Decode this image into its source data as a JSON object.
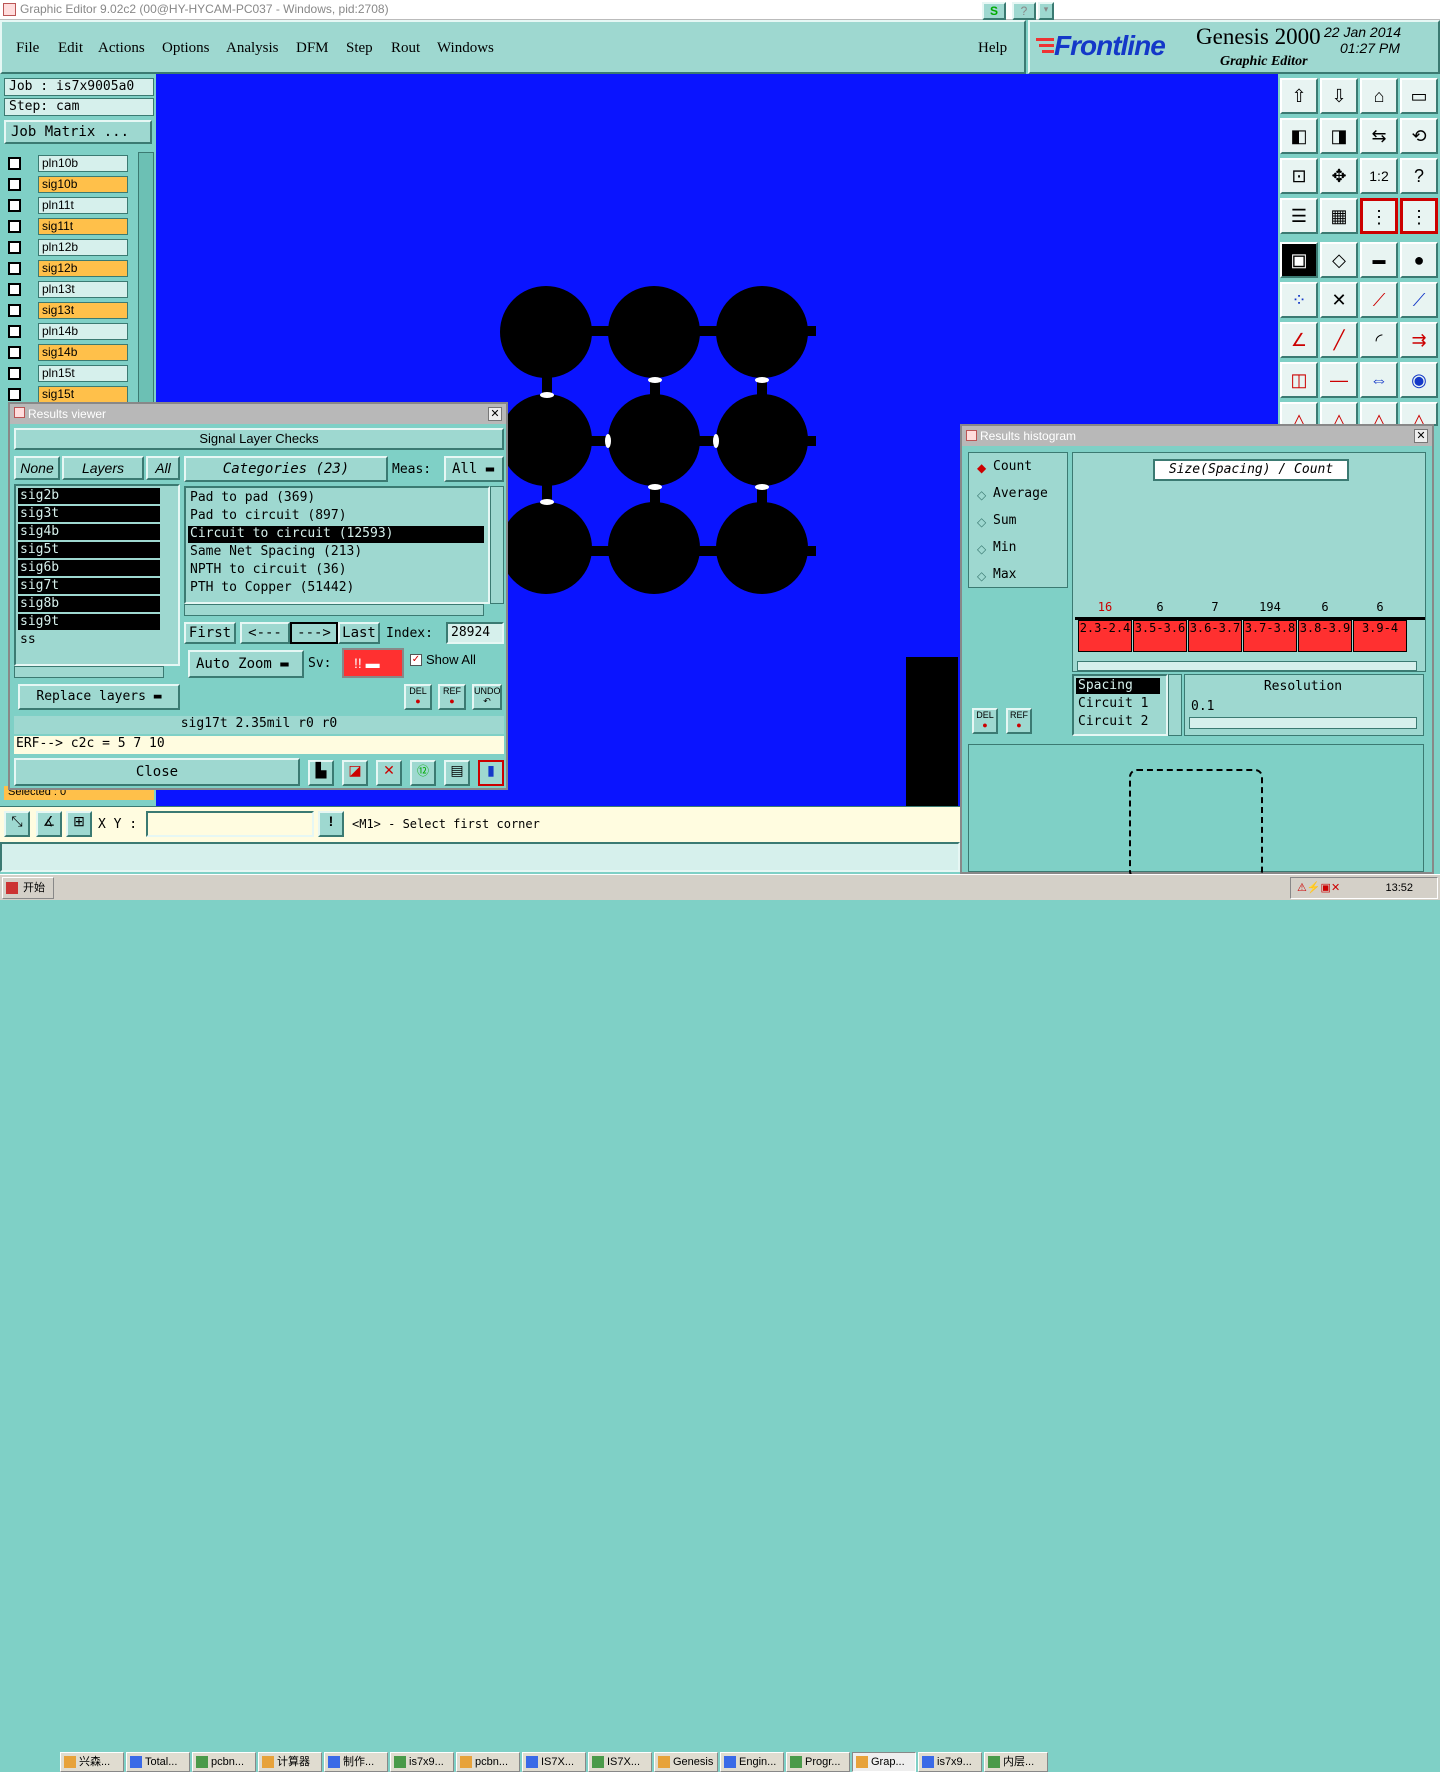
{
  "window_title": "Graphic Editor 9.02c2 (00@HY-HYCAM-PC037 - Windows, pid:2708)",
  "menu": [
    "File",
    "Edit",
    "Actions",
    "Options",
    "Analysis",
    "DFM",
    "Step",
    "Rout",
    "Windows"
  ],
  "help": "Help",
  "brand": {
    "logo": "Frontline",
    "product": "Genesis 2000",
    "sub": "Graphic Editor",
    "date": "22 Jan 2014",
    "time": "01:27 PM"
  },
  "job": {
    "job": "Job  : is7x9005a0",
    "step": "Step: cam",
    "matrix": "Job Matrix ..."
  },
  "layers": [
    {
      "name": "pln10b",
      "type": "plane"
    },
    {
      "name": "sig10b",
      "type": "signal"
    },
    {
      "name": "pln11t",
      "type": "plane"
    },
    {
      "name": "sig11t",
      "type": "signal"
    },
    {
      "name": "pln12b",
      "type": "plane"
    },
    {
      "name": "sig12b",
      "type": "signal"
    },
    {
      "name": "pln13t",
      "type": "plane"
    },
    {
      "name": "sig13t",
      "type": "signal"
    },
    {
      "name": "pln14b",
      "type": "plane"
    },
    {
      "name": "sig14b",
      "type": "signal"
    },
    {
      "name": "pln15t",
      "type": "plane"
    },
    {
      "name": "sig15t",
      "type": "signal"
    }
  ],
  "selected_status": "Selected : 0",
  "results_viewer": {
    "title": "Results viewer",
    "header": "Signal Layer Checks",
    "none": "None",
    "layers": "Layers",
    "all": "All",
    "categories": "Categories (23)",
    "meas": "Meas:",
    "meas_value": "All",
    "layer_list": [
      "sig2b",
      "sig3t",
      "sig4b",
      "sig5t",
      "sig6b",
      "sig7t",
      "sig8b",
      "sig9t",
      "ss"
    ],
    "category_list": [
      "Pad to pad (369)",
      "Pad to circuit (897)",
      "Circuit to circuit (12593)",
      "Same Net Spacing (213)",
      "NPTH to circuit (36)",
      "PTH to Copper (51442)"
    ],
    "selected_category": 2,
    "first": "First",
    "prev": "<---",
    "next": "--->",
    "last": "Last",
    "index_label": "Index:",
    "index_value": "28924",
    "auto_zoom": "Auto Zoom",
    "sv": "Sv:",
    "sv_value": "!!",
    "show_all": "Show All",
    "replace_layers": "Replace layers",
    "del": "DEL",
    "ref": "REF",
    "undo": "UNDO",
    "status_line": "sig17t 2.35mil  r0  r0",
    "erf_line": "ERF--> c2c = 5 7 10",
    "close": "Close"
  },
  "xy_label": "X Y :",
  "prompt": "<M1> - Select first corner",
  "histogram": {
    "title": "Results histogram",
    "modes": [
      "Count",
      "Average",
      "Sum",
      "Min",
      "Max"
    ],
    "selected_mode": 0,
    "chart_title": "Size(Spacing) / Count",
    "bars": [
      {
        "count": "16",
        "range": "2.3-2.4"
      },
      {
        "count": "6",
        "range": "3.5-3.6"
      },
      {
        "count": "7",
        "range": "3.6-3.7"
      },
      {
        "count": "194",
        "range": "3.7-3.8"
      },
      {
        "count": "6",
        "range": "3.8-3.9"
      },
      {
        "count": "6",
        "range": "3.9-4"
      }
    ],
    "list": [
      "Spacing",
      "Circuit 1",
      "Circuit 2"
    ],
    "resolution_label": "Resolution",
    "resolution_value": "0.1",
    "del": "DEL",
    "ref": "REF"
  },
  "taskbar": {
    "start": "开始",
    "items": [
      "兴森...",
      "Total...",
      "pcbn...",
      "计算器",
      "制作...",
      "is7x9...",
      "pcbn...",
      "IS7X...",
      "IS7X...",
      "Genesis",
      "Engin...",
      "Progr...",
      "Grap...",
      "is7x9...",
      "内层..."
    ],
    "clock": "13:52"
  },
  "colors": {
    "bg": "#7fd0c6",
    "canvas": "#0a14ff",
    "signal": "#ffc04a",
    "highlight": "#ff3030"
  }
}
